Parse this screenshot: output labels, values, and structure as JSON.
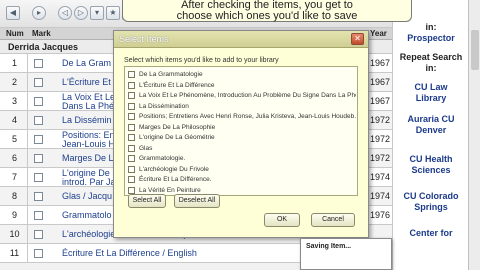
{
  "toolbar": {
    "buttons": [
      "◀",
      "▸",
      "◁",
      "▷",
      "▾",
      "★",
      "⎘"
    ]
  },
  "tooltip": {
    "line1": "After checking the items, you get to",
    "line2": "choose which ones you'd like to save"
  },
  "table": {
    "headers": {
      "num": "Num",
      "mark": "Mark",
      "year": "Year"
    },
    "group": "Derrida Jacques",
    "rows": [
      {
        "num": "1",
        "title": "De La Gram",
        "year": "1967"
      },
      {
        "num": "2",
        "title": "L'Écriture Et",
        "year": "1967"
      },
      {
        "num": "3",
        "title": "La Voix Et Le\nDans La Phé",
        "year": "1967"
      },
      {
        "num": "4",
        "title": "La Dissémin",
        "year": "1972"
      },
      {
        "num": "5",
        "title": "Positions: En\nJean-Louis H",
        "year": "1972"
      },
      {
        "num": "6",
        "title": "Marges De La",
        "year": "1972"
      },
      {
        "num": "7",
        "title": "L'origine De\nintrod. Par Ja",
        "year": "1974"
      },
      {
        "num": "8",
        "title": "Glas / Jacqu",
        "year": "1974"
      },
      {
        "num": "9",
        "title": "Grammatolo",
        "year": "1976"
      },
      {
        "num": "10",
        "title": "L'archéologie Du Frivole / Jacques Derrida",
        "year": ""
      },
      {
        "num": "11",
        "title": "Écriture Et La Différence / English",
        "year": ""
      }
    ]
  },
  "sidebar": {
    "prospector_partial": "in:",
    "prospector": "Prospector",
    "repeat_search": "Repeat Search in:",
    "links": [
      "CU Law Library",
      "Auraria CU Denver",
      "CU Health Sciences",
      "CU Colorado Springs",
      "Center for"
    ]
  },
  "dialog": {
    "title": "Select Items",
    "close_glyph": "✕",
    "instruction": "Select which items you'd like to add to your library",
    "items": [
      "De La Grammatologie",
      "L'Écriture Et La Différence",
      "La Voix Et Le Phénomène, Introduction Au Problème Du Signe Dans La Phé...",
      "La Dissémination",
      "Positions; Entretiens Avec Henri Ronse, Julia Kristeva, Jean-Louis Houdeb...",
      "Marges De La Philosophie",
      "L'origine De La Géométrie",
      "Glas",
      "Grammatologie.",
      "L'archéologie Du Frivole",
      "Écriture Et La Différence.",
      "La Vérité En Peinture"
    ],
    "select_all": "Select All",
    "deselect_all": "Deselect All",
    "ok": "OK",
    "cancel": "Cancel"
  },
  "saving": {
    "label": "Saving Item..."
  }
}
